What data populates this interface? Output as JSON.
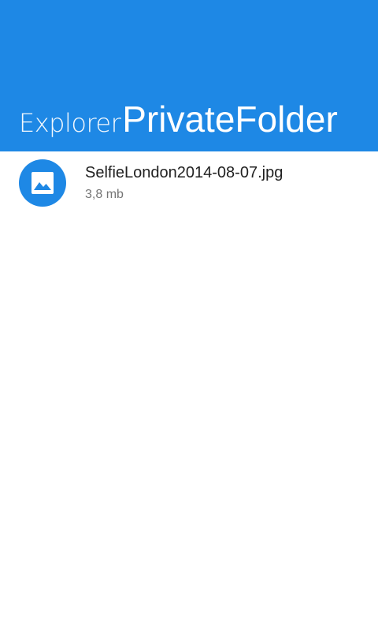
{
  "header": {
    "app_name": "Explorer",
    "folder_name": "PrivateFolder",
    "background_color": "#1e88e5"
  },
  "files": [
    {
      "name": "SelfieLondon2014-08-07.jpg",
      "size": "3,8 mb",
      "icon": "image-icon",
      "icon_color": "#1e88e5"
    }
  ]
}
